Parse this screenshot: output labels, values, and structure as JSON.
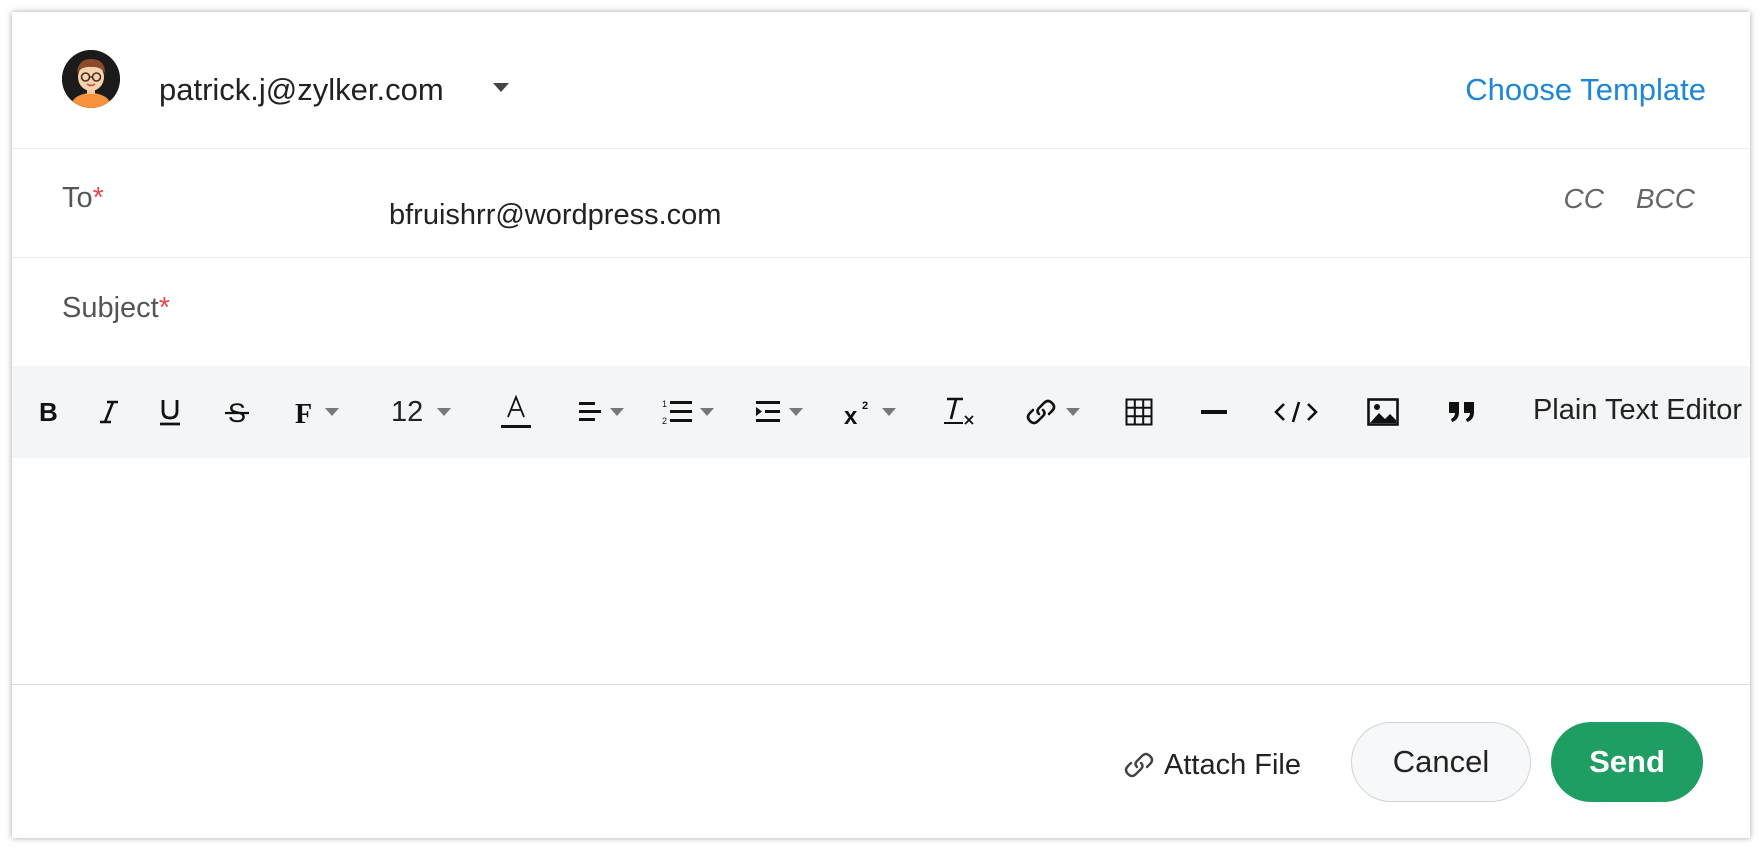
{
  "header": {
    "from_email": "patrick.j@zylker.com",
    "choose_template_label": "Choose Template"
  },
  "to": {
    "label": "To",
    "required_mark": "*",
    "value": "bfruishrr@wordpress.com",
    "cc_label": "CC",
    "bcc_label": "BCC"
  },
  "subject": {
    "label": "Subject",
    "required_mark": "*",
    "value": ""
  },
  "toolbar": {
    "font_size": "12",
    "plain_text_label": "Plain Text Editor",
    "tools": [
      "bold-icon",
      "italic-icon",
      "underline-icon",
      "strikethrough-icon",
      "font-family-icon",
      "font-size-select",
      "font-color-icon",
      "align-icon",
      "numbered-list-icon",
      "indent-icon",
      "superscript-icon",
      "clear-format-icon",
      "link-icon",
      "table-icon",
      "horizontal-line-icon",
      "code-icon",
      "image-icon",
      "quote-icon"
    ]
  },
  "footer": {
    "attach_label": "Attach File",
    "cancel_label": "Cancel",
    "send_label": "Send"
  },
  "colors": {
    "link_blue": "#1f86d8",
    "send_green": "#1f9e63",
    "required_red": "#e5484d",
    "toolbar_bg": "#f4f5f7"
  }
}
